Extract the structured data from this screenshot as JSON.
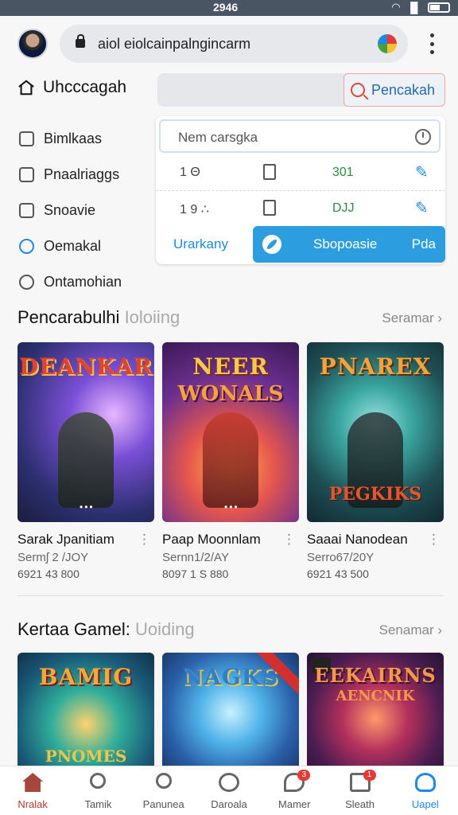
{
  "status_bar": {
    "time": "2946",
    "icons": [
      "wifi-icon",
      "signal-icon",
      "battery-icon"
    ]
  },
  "browser": {
    "url": "aiol eiolcainpalngincarm"
  },
  "header": {
    "title": "Uhcccagah"
  },
  "search": {
    "button_label": "Pencakah",
    "panel_placeholder": "Nem carsgka"
  },
  "menu": {
    "items": [
      {
        "label": "Bimlkaas",
        "icon": "mail-icon"
      },
      {
        "label": "Pnaalriaggs",
        "icon": "file-icon"
      },
      {
        "label": "Snoavie",
        "icon": "doc-icon"
      },
      {
        "label": "Oemakal",
        "icon": "globe-icon"
      },
      {
        "label": "Ontamohian",
        "icon": "timer-icon"
      }
    ]
  },
  "panel": {
    "rows": [
      {
        "a": "1 Θ",
        "g": "301"
      },
      {
        "a": "1 9 ∴",
        "g": "DJJ"
      }
    ],
    "bottom": {
      "left": "Urarkany",
      "right": "Sbopoasie",
      "right2": "Pda"
    }
  },
  "section1": {
    "title": "Pencarabulhi",
    "subtitle": "Ioloiing",
    "more": "Seramar",
    "tiles": [
      {
        "logo": "DEANKAR",
        "title": "Sarak Jpanitiam",
        "sub": "Sermʃ 2 /JOY",
        "meta": "6921 43 800"
      },
      {
        "logo": "NEER",
        "logo2": "WONALS",
        "title": "Paap Moonnlam",
        "sub": "Sernn1/2/AY",
        "meta": "8097 1 S 880"
      },
      {
        "logo": "PNAREX",
        "logo2": "PEGKIKS",
        "title": "Saaai Nanodean",
        "sub": "Serro67/20Y",
        "meta": "6921 43 500"
      }
    ]
  },
  "section2": {
    "title": "Kertaa Gamel:",
    "subtitle": "Uoiding",
    "more": "Senamar",
    "tiles": [
      {
        "logo": "BAMIG",
        "logo2": "PNOMES"
      },
      {
        "logo": "NAGKS"
      },
      {
        "logo": "EEKAIRNS",
        "logo2": "AENCNIK"
      }
    ]
  },
  "bottom_nav": [
    {
      "label": "Nralak",
      "icon": "home-icon"
    },
    {
      "label": "Tamik",
      "icon": "search-icon"
    },
    {
      "label": "Panunea",
      "icon": "search-icon"
    },
    {
      "label": "Daroala",
      "icon": "circle-icon"
    },
    {
      "label": "Mamer",
      "icon": "chat-icon",
      "badge": "3"
    },
    {
      "label": "Sleath",
      "icon": "doc-icon",
      "badge": "1"
    },
    {
      "label": "Uapel",
      "icon": "user-icon"
    }
  ]
}
